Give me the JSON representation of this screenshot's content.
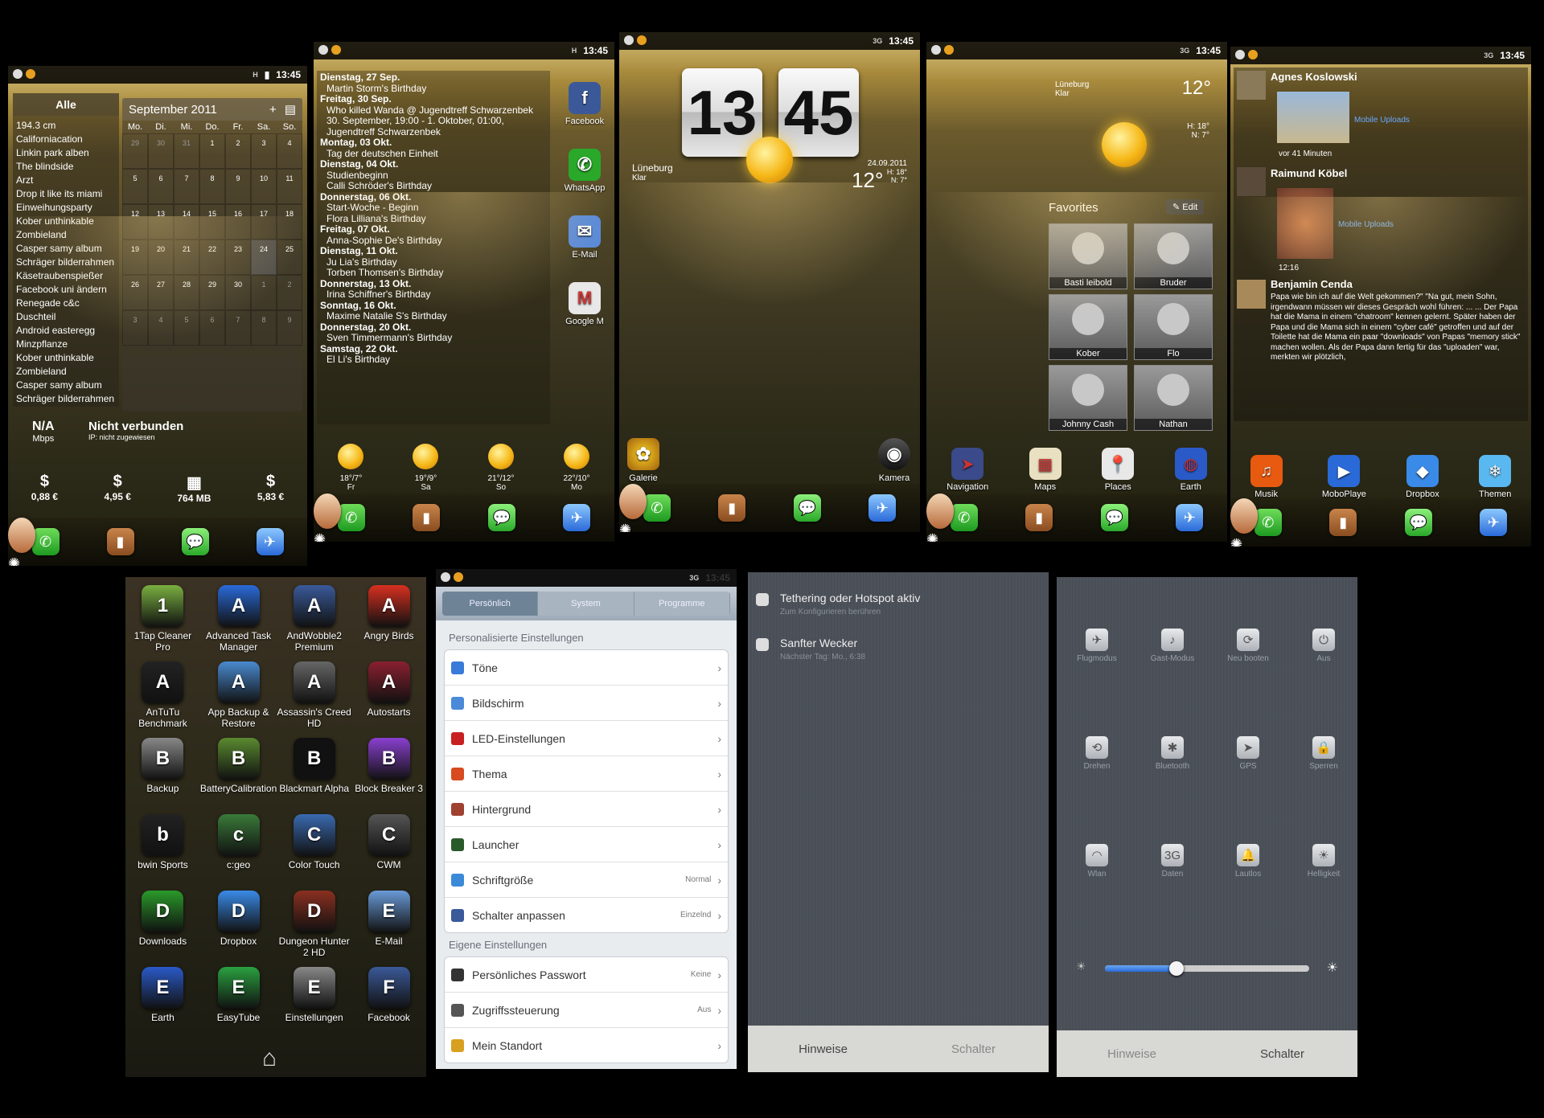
{
  "status": {
    "time": "13:45",
    "net_h": "H",
    "net_3g": "3G"
  },
  "p1": {
    "list_title": "Alle",
    "list_items": [
      "194.3 cm",
      "Californiacation",
      "Linkin park alben",
      "The blindside",
      "Arzt",
      "Drop it like its miami",
      "Einweihungsparty",
      "Kober unthinkable",
      "Zombieland",
      "Casper samy album",
      "Schräger bilderrahmen",
      "Käsetraubenspießer",
      "Facebook uni ändern",
      "Renegade c&c",
      "Duschteil",
      "Android easteregg",
      "Minzpflanze",
      "Kober unthinkable",
      "Zombieland",
      "Casper samy album",
      "Schräger bilderrahmen"
    ],
    "cal_month": "September 2011",
    "cal_weekdays": [
      "Mo.",
      "Di.",
      "Mi.",
      "Do.",
      "Fr.",
      "Sa.",
      "So."
    ],
    "cal_days": [
      "29",
      "30",
      "31",
      "1",
      "2",
      "3",
      "4",
      "5",
      "6",
      "7",
      "8",
      "9",
      "10",
      "11",
      "12",
      "13",
      "14",
      "15",
      "16",
      "17",
      "18",
      "19",
      "20",
      "21",
      "22",
      "23",
      "24",
      "25",
      "26",
      "27",
      "28",
      "29",
      "30",
      "1",
      "2",
      "3",
      "4",
      "5",
      "6",
      "7",
      "8",
      "9"
    ],
    "speed": "N/A",
    "speed_unit": "Mbps",
    "conn": "Nicht verbunden",
    "ip": "IP: nicht zugewiesen",
    "stats": [
      {
        "icon": "$",
        "label": "0,88 €"
      },
      {
        "icon": "$",
        "label": "4,95 €"
      },
      {
        "icon": "▦",
        "label": "764 MB"
      },
      {
        "icon": "$",
        "label": "5,83 €"
      }
    ]
  },
  "p2": {
    "agenda": [
      "Dienstag, 27 Sep.",
      "Martin Storm's Birthday",
      "Freitag, 30 Sep.",
      "Who killed Wanda @ Jugendtreff Schwarzenbek",
      "30. September, 19:00 - 1. Oktober, 01:00,",
      "Jugendtreff Schwarzenbek",
      "Montag, 03 Okt.",
      "Tag der deutschen Einheit",
      "Dienstag, 04 Okt.",
      "Studienbeginn",
      "Calli Schröder's Birthday",
      "Donnerstag, 06 Okt.",
      "Start-Woche - Beginn",
      "Flora Lilliana's Birthday",
      "Freitag, 07 Okt.",
      "Anna-Sophie De's Birthday",
      "Dienstag, 11 Okt.",
      "Ju Lia's Birthday",
      "Torben Thomsen's Birthday",
      "Donnerstag, 13 Okt.",
      "Irina Schiffner's Birthday",
      "Sonntag, 16 Okt.",
      "Maxime Natalie S's Birthday",
      "Donnerstag, 20 Okt.",
      "Sven Timmermann's Birthday",
      "Samstag, 22 Okt.",
      "El Li's Birthday"
    ],
    "apps": [
      "Facebook",
      "WhatsApp",
      "E-Mail",
      "Google M"
    ],
    "forecast": [
      {
        "temp": "18°/7°",
        "day": "Fr"
      },
      {
        "temp": "19°/9°",
        "day": "Sa"
      },
      {
        "temp": "21°/12°",
        "day": "So"
      },
      {
        "temp": "22°/10°",
        "day": "Mo"
      }
    ]
  },
  "p3": {
    "hour": "13",
    "minute": "45",
    "city": "Lüneburg",
    "cond": "Klar",
    "date": "24.09.2011",
    "temp": "12°",
    "hi": "H: 18°",
    "lo": "N: 7°",
    "app1": "Galerie",
    "app2": "Kamera"
  },
  "p4": {
    "city": "Lüneburg",
    "cond": "Klar",
    "temp": "12°",
    "hi": "H: 18°",
    "lo": "N: 7°",
    "fav_title": "Favorites",
    "edit": "Edit",
    "favorites": [
      "Basti leibold",
      "Bruder",
      "Kober",
      "Flo",
      "Johnny Cash",
      "Nathan"
    ],
    "apps": [
      "Navigation",
      "Maps",
      "Places",
      "Earth"
    ]
  },
  "p5": {
    "posts": [
      {
        "name": "Agnes Koslowski",
        "meta": "Mobile Uploads",
        "time": "vor 41 Minuten"
      },
      {
        "name": "Raimund Köbel",
        "meta": "Mobile Uploads",
        "time": "12:16"
      },
      {
        "name": "Benjamin Cenda",
        "text": "Papa wie bin ich auf die Welt gekommen?\" \"Na gut, mein Sohn, irgendwann müssen wir dieses Gespräch wohl führen: ... ... Der Papa hat die Mama in einem \"chatroom\" kennen gelernt. Später haben der Papa und die Mama sich in einem \"cyber café\" getroffen und auf der Toilette hat die Mama ein paar \"downloads\" von Papas \"memory stick\" machen wollen. Als der Papa dann fertig für das \"uploaden\" war, merkten wir plötzlich,"
      }
    ],
    "apps": [
      "Musik",
      "MoboPlaye",
      "Dropbox",
      "Themen"
    ]
  },
  "drawer": {
    "apps": [
      {
        "l": "1Tap Cleaner Pro",
        "c": "#7ab040"
      },
      {
        "l": "Advanced Task Manager",
        "c": "#2a6ad8"
      },
      {
        "l": "AndWobble2 Premium",
        "c": "#3a5a9a"
      },
      {
        "l": "Angry Birds",
        "c": "#d83020"
      },
      {
        "l": "AnTuTu Benchmark",
        "c": "#222"
      },
      {
        "l": "App Backup & Restore",
        "c": "#4a8ad0"
      },
      {
        "l": "Assassin's Creed HD",
        "c": "#666"
      },
      {
        "l": "Autostarts",
        "c": "#8a2030"
      },
      {
        "l": "Backup",
        "c": "#888"
      },
      {
        "l": "BatteryCalibration",
        "c": "#5a8a30"
      },
      {
        "l": "Blackmart Alpha",
        "c": "#111"
      },
      {
        "l": "Block Breaker 3",
        "c": "#8a40d0"
      },
      {
        "l": "bwin Sports",
        "c": "#222"
      },
      {
        "l": "c:geo",
        "c": "#3a7a3a"
      },
      {
        "l": "Color Touch",
        "c": "#3a6ab0"
      },
      {
        "l": "CWM",
        "c": "#555"
      },
      {
        "l": "Downloads",
        "c": "#2a9a2a"
      },
      {
        "l": "Dropbox",
        "c": "#3a8ae8"
      },
      {
        "l": "Dungeon Hunter 2 HD",
        "c": "#8a3020"
      },
      {
        "l": "E-Mail",
        "c": "#6a9ad8"
      },
      {
        "l": "Earth",
        "c": "#2a5ac8"
      },
      {
        "l": "EasyTube",
        "c": "#2aa040"
      },
      {
        "l": "Einstellungen",
        "c": "#888"
      },
      {
        "l": "Facebook",
        "c": "#3b5998"
      }
    ]
  },
  "settings": {
    "tabs": [
      "Persönlich",
      "System",
      "Programme"
    ],
    "sec1": "Personalisierte Einstellungen",
    "rows1": [
      {
        "l": "Töne",
        "v": "",
        "c": "#3a7ad8"
      },
      {
        "l": "Bildschirm",
        "v": "",
        "c": "#4a8ad8"
      },
      {
        "l": "LED-Einstellungen",
        "v": "",
        "c": "#c82020"
      },
      {
        "l": "Thema",
        "v": "",
        "c": "#d84a20"
      },
      {
        "l": "Hintergrund",
        "v": "",
        "c": "#a04030"
      },
      {
        "l": "Launcher",
        "v": "",
        "c": "#2a5a2a"
      },
      {
        "l": "Schriftgröße",
        "v": "Normal",
        "c": "#3a8ad8"
      },
      {
        "l": "Schalter anpassen",
        "v": "Einzelnd",
        "c": "#3a5a9a"
      }
    ],
    "sec2": "Eigene Einstellungen",
    "rows2": [
      {
        "l": "Persönliches Passwort",
        "v": "Keine",
        "c": "#333"
      },
      {
        "l": "Zugriffssteuerung",
        "v": "Aus",
        "c": "#555"
      },
      {
        "l": "Mein Standort",
        "v": "",
        "c": "#d8a020"
      }
    ]
  },
  "notif": {
    "items": [
      {
        "t": "Tethering oder Hotspot aktiv",
        "s": "Zum Konfigurieren berühren"
      },
      {
        "t": "Sanfter Wecker",
        "s": "Nächster Tag: Mo., 6:38"
      }
    ],
    "tab1": "Hinweise",
    "tab2": "Schalter"
  },
  "toggles": {
    "items": [
      "Flugmodus",
      "Gast-Modus",
      "Neu booten",
      "Aus",
      "Drehen",
      "Bluetooth",
      "GPS",
      "Sperren",
      "Wlan",
      "Daten",
      "Lautlos",
      "Helligkeit"
    ],
    "brightness": 0.35,
    "tab1": "Hinweise",
    "tab2": "Schalter"
  }
}
